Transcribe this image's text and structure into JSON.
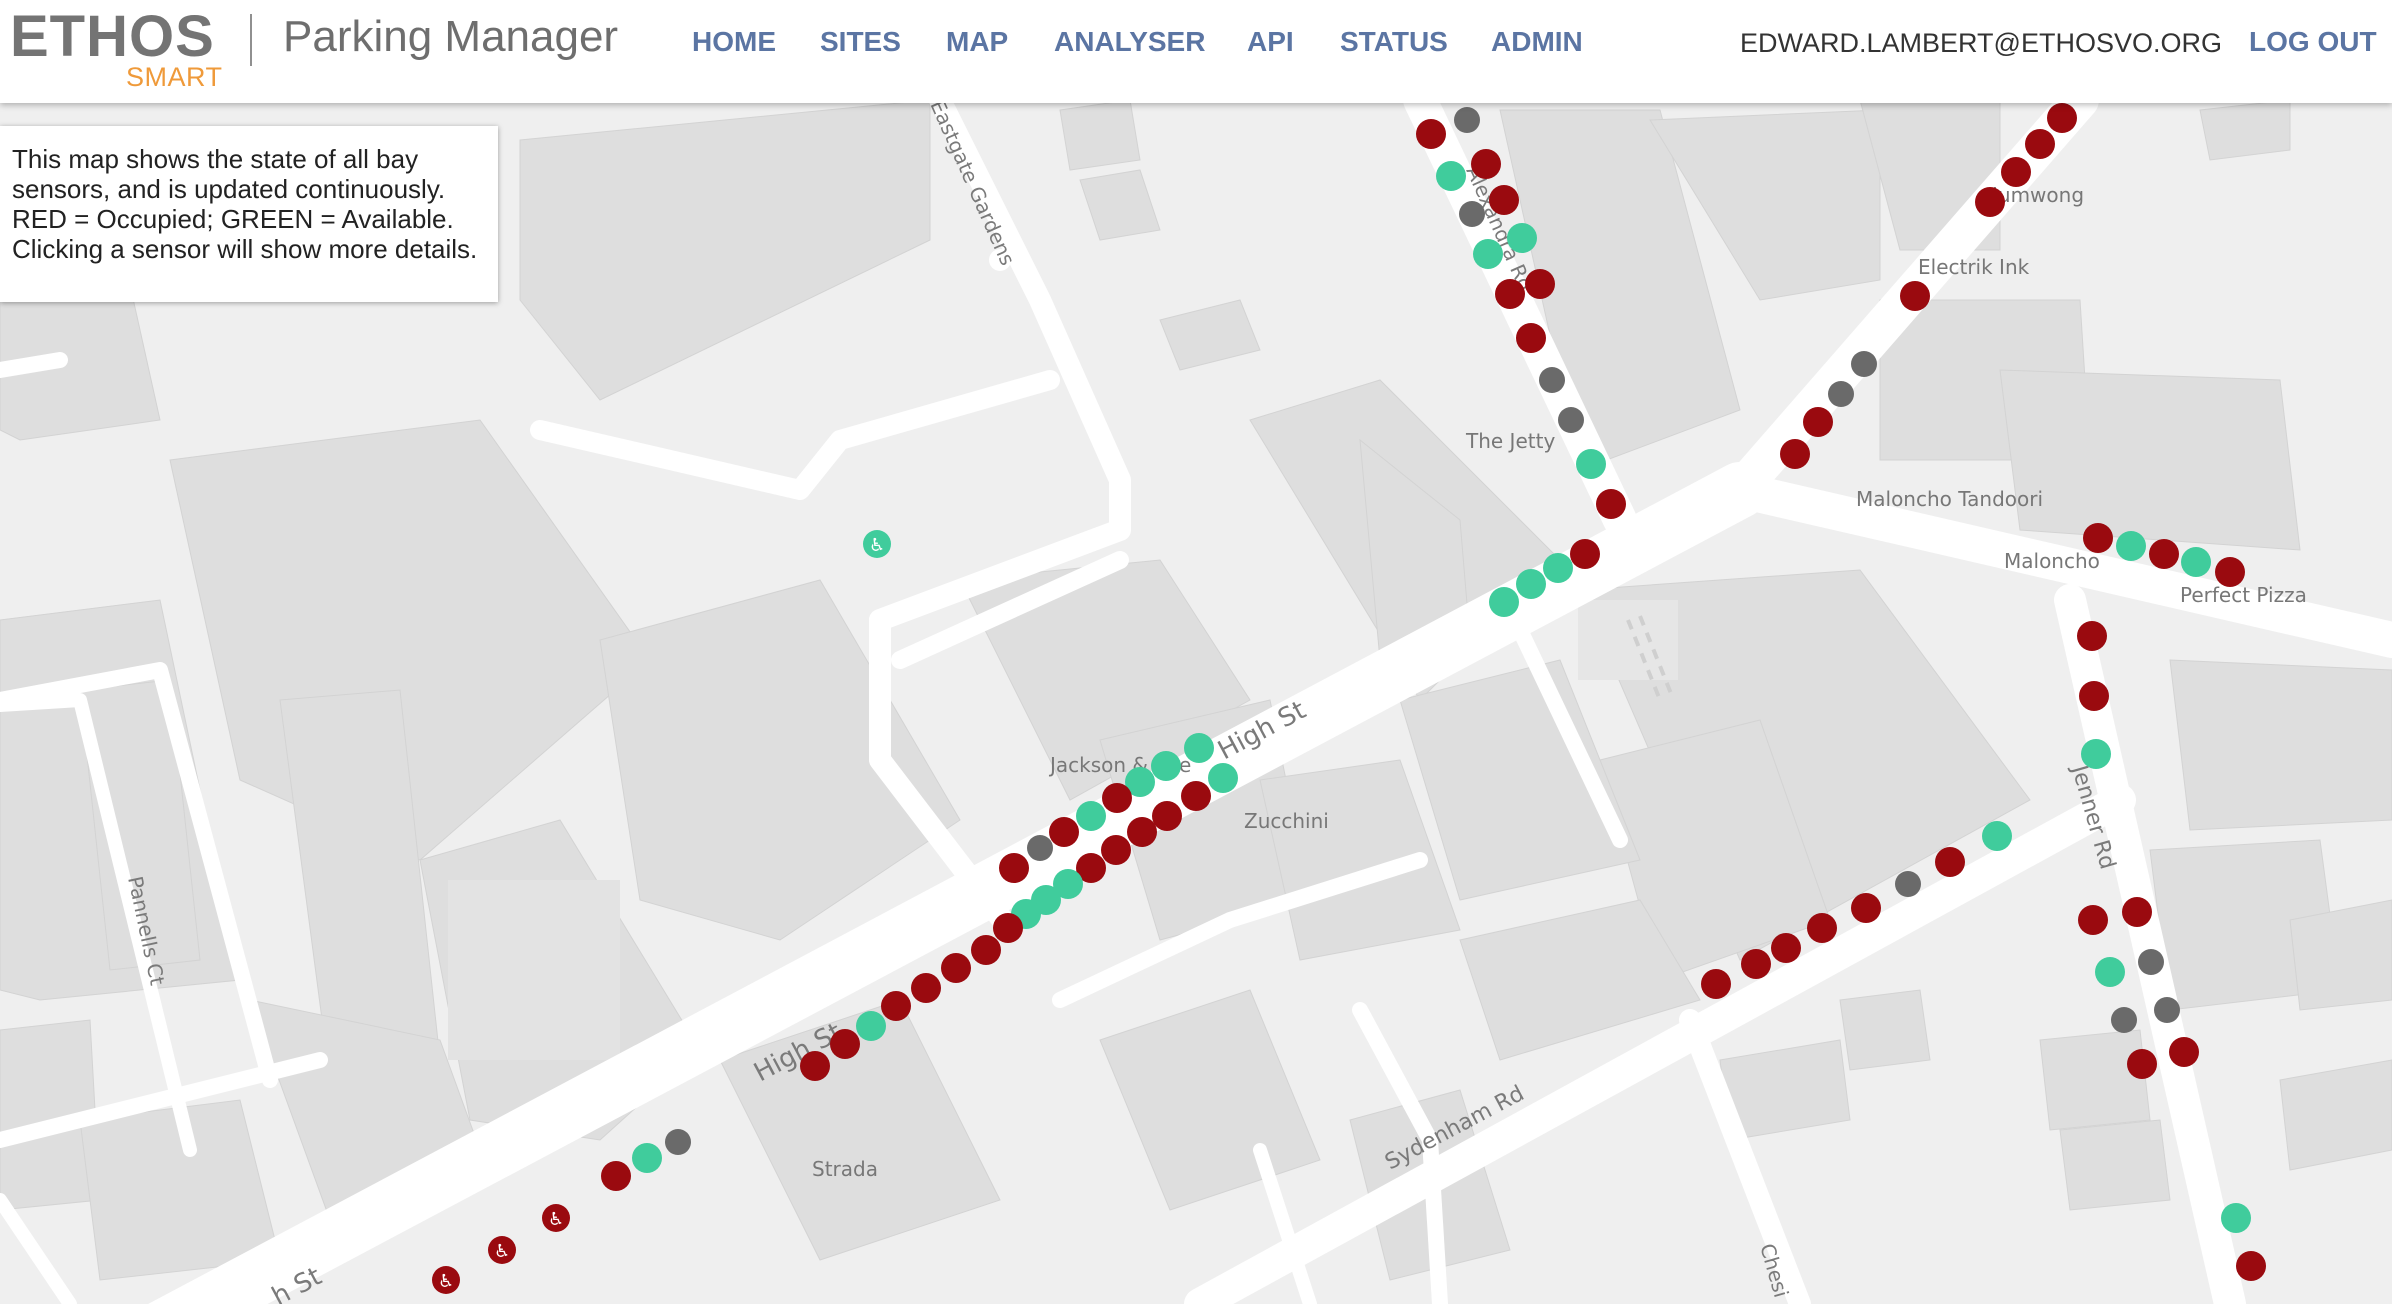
{
  "header": {
    "logo_main": "ETHOS",
    "logo_sub": "SMART",
    "app_title": "Parking Manager",
    "nav": [
      "HOME",
      "SITES",
      "MAP",
      "ANALYSER",
      "API",
      "STATUS",
      "ADMIN"
    ],
    "user_email": "EDWARD.LAMBERT@ETHOSVO.ORG",
    "logout_label": "LOG OUT"
  },
  "info_box": {
    "text": "This map shows the state of all bay sensors, and is updated continuously. RED = Occupied; GREEN = Available. Clicking a sensor will show more details."
  },
  "map": {
    "road_labels": [
      "High St",
      "High St",
      "h St",
      "Eastgate Gardens",
      "Pannells Ct",
      "Sydenham Rd",
      "Jenner Rd",
      "Alexandra Rd",
      "Chesi"
    ],
    "poi_labels": [
      "Jumwong",
      "Electrik Ink",
      "The Jetty",
      "Maloncho Tandoori",
      "Maloncho",
      "Perfect Pizza",
      "Jackson & Rye",
      "Zucchini",
      "Strada"
    ],
    "colors": {
      "occupied": "#9a0a0f",
      "available": "#40cc9c",
      "unknown": "#6a6a6a",
      "road": "#ffffff",
      "building": "#dddddd",
      "background": "#efefef",
      "nav_link": "#5b75a3",
      "logo_accent": "#ef9a3a"
    },
    "sensor_legend": {
      "occupied": "RED = Occupied",
      "available": "GREEN = Available"
    }
  }
}
